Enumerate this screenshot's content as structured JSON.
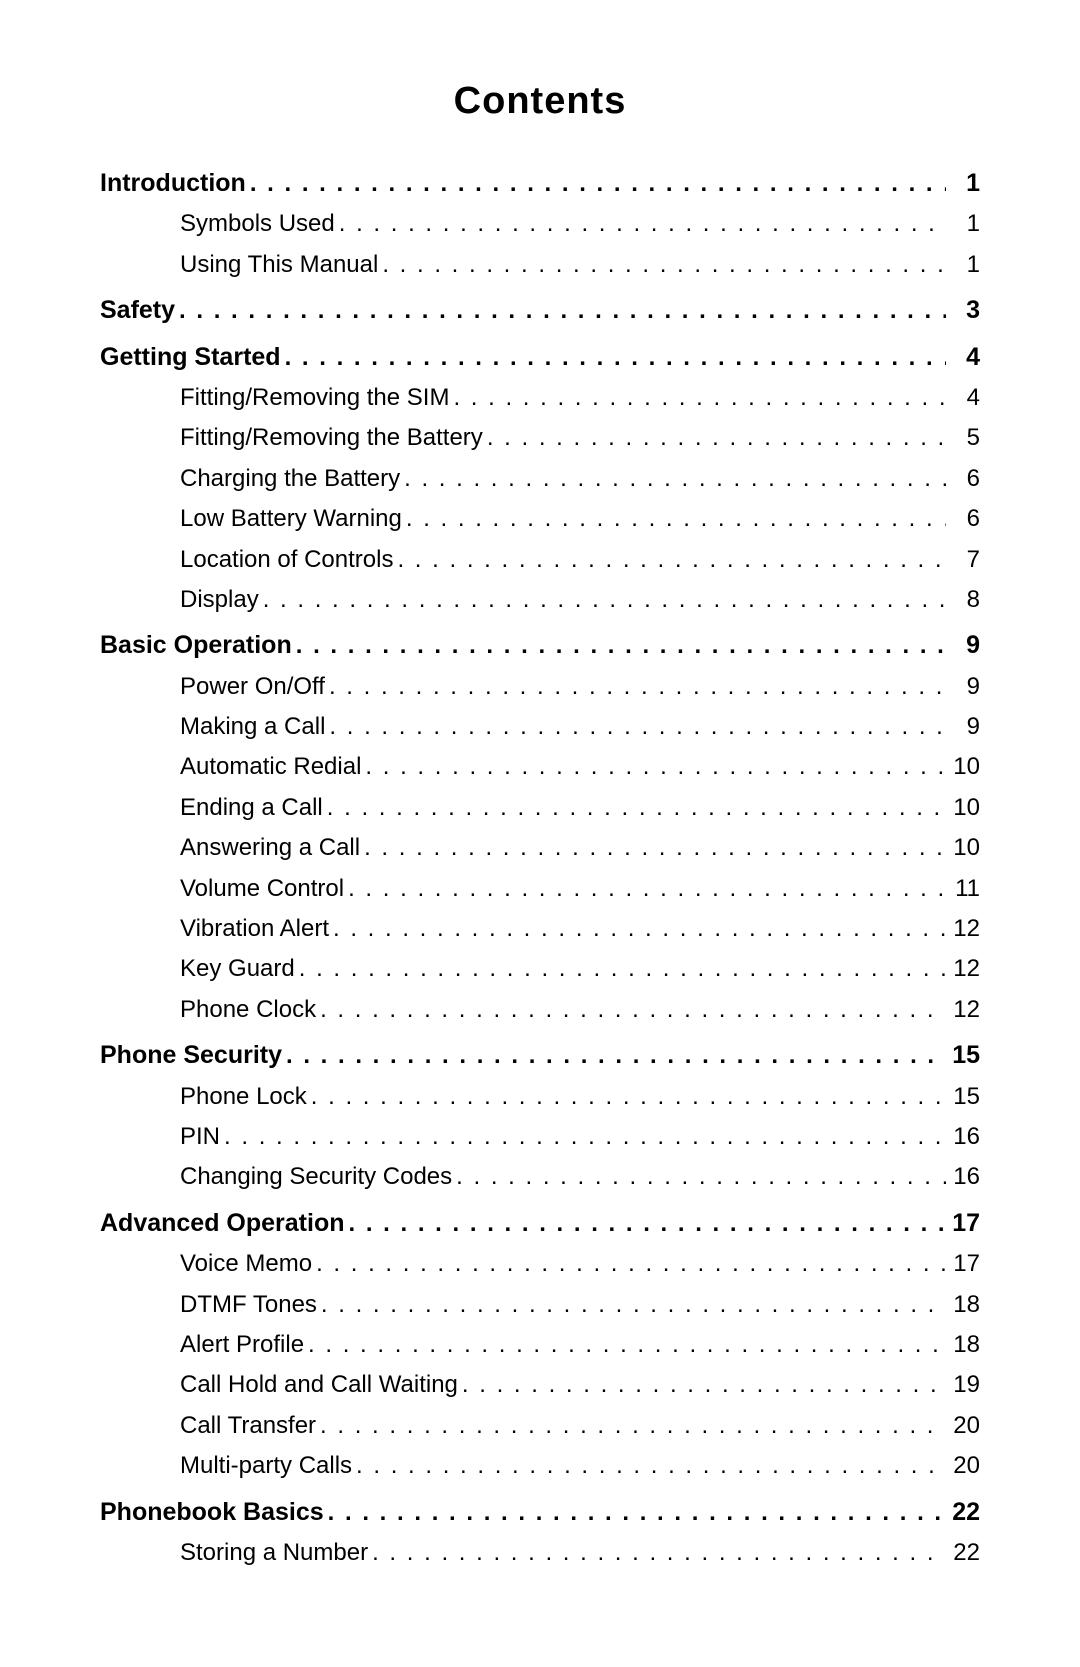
{
  "title": "Contents",
  "entries": [
    {
      "label": "Introduction",
      "page": "1",
      "indent": false,
      "bold": true
    },
    {
      "label": "Symbols Used",
      "page": "1",
      "indent": true,
      "bold": false
    },
    {
      "label": "Using This Manual",
      "page": "1",
      "indent": true,
      "bold": false
    },
    {
      "label": "Safety",
      "page": "3",
      "indent": false,
      "bold": true
    },
    {
      "label": "Getting Started",
      "page": "4",
      "indent": false,
      "bold": true
    },
    {
      "label": "Fitting/Removing the SIM",
      "page": "4",
      "indent": true,
      "bold": false
    },
    {
      "label": "Fitting/Removing the Battery",
      "page": "5",
      "indent": true,
      "bold": false
    },
    {
      "label": "Charging the Battery",
      "page": "6",
      "indent": true,
      "bold": false
    },
    {
      "label": "Low Battery Warning",
      "page": "6",
      "indent": true,
      "bold": false
    },
    {
      "label": "Location of Controls",
      "page": "7",
      "indent": true,
      "bold": false
    },
    {
      "label": "Display",
      "page": "8",
      "indent": true,
      "bold": false
    },
    {
      "label": "Basic Operation",
      "page": "9",
      "indent": false,
      "bold": true
    },
    {
      "label": "Power On/Off",
      "page": "9",
      "indent": true,
      "bold": false
    },
    {
      "label": "Making a Call",
      "page": "9",
      "indent": true,
      "bold": false
    },
    {
      "label": "Automatic Redial",
      "page": "10",
      "indent": true,
      "bold": false
    },
    {
      "label": "Ending a Call",
      "page": "10",
      "indent": true,
      "bold": false
    },
    {
      "label": "Answering a Call",
      "page": "10",
      "indent": true,
      "bold": false
    },
    {
      "label": "Volume Control",
      "page": "11",
      "indent": true,
      "bold": false
    },
    {
      "label": "Vibration Alert",
      "page": "12",
      "indent": true,
      "bold": false
    },
    {
      "label": "Key Guard",
      "page": "12",
      "indent": true,
      "bold": false
    },
    {
      "label": "Phone Clock",
      "page": "12",
      "indent": true,
      "bold": false
    },
    {
      "label": "Phone Security",
      "page": "15",
      "indent": false,
      "bold": true
    },
    {
      "label": "Phone Lock",
      "page": "15",
      "indent": true,
      "bold": false
    },
    {
      "label": "PIN",
      "page": "16",
      "indent": true,
      "bold": false
    },
    {
      "label": "Changing Security Codes",
      "page": "16",
      "indent": true,
      "bold": false
    },
    {
      "label": "Advanced Operation",
      "page": "17",
      "indent": false,
      "bold": true
    },
    {
      "label": "Voice Memo",
      "page": "17",
      "indent": true,
      "bold": false
    },
    {
      "label": "DTMF Tones",
      "page": "18",
      "indent": true,
      "bold": false
    },
    {
      "label": "Alert Profile",
      "page": "18",
      "indent": true,
      "bold": false
    },
    {
      "label": "Call Hold and Call Waiting",
      "page": "19",
      "indent": true,
      "bold": false
    },
    {
      "label": "Call Transfer",
      "page": "20",
      "indent": true,
      "bold": false
    },
    {
      "label": "Multi-party Calls",
      "page": "20",
      "indent": true,
      "bold": false
    },
    {
      "label": "Phonebook Basics",
      "page": "22",
      "indent": false,
      "bold": true
    },
    {
      "label": "Storing a Number",
      "page": "22",
      "indent": true,
      "bold": false
    }
  ]
}
